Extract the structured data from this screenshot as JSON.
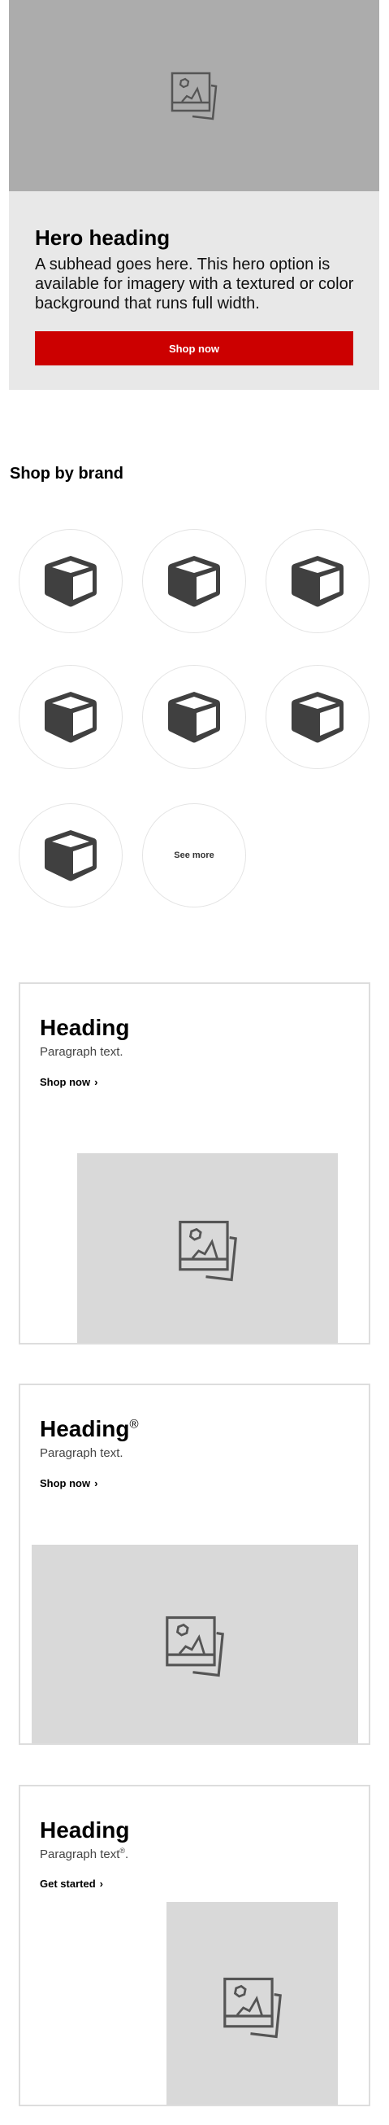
{
  "hero": {
    "heading": "Hero heading",
    "subhead": "A subhead goes here. This hero option is available for imagery with a textured or color background that runs full width.",
    "button_label": "Shop now",
    "accent_color": "#cc0000"
  },
  "brands": {
    "heading": "Shop by brand",
    "items": [
      "brand-1",
      "brand-2",
      "brand-3",
      "brand-4",
      "brand-5",
      "brand-6",
      "brand-7"
    ],
    "see_more_label": "See more"
  },
  "cards": [
    {
      "heading": "Heading",
      "paragraph": "Paragraph text.",
      "link": "Shop now"
    },
    {
      "heading": "Heading",
      "heading_mark": "®",
      "paragraph": "Paragraph text.",
      "link": "Shop now"
    },
    {
      "heading": "Heading",
      "paragraph": "Paragraph text",
      "paragraph_mark": "®",
      "paragraph_end": ".",
      "link": "Get started"
    }
  ]
}
